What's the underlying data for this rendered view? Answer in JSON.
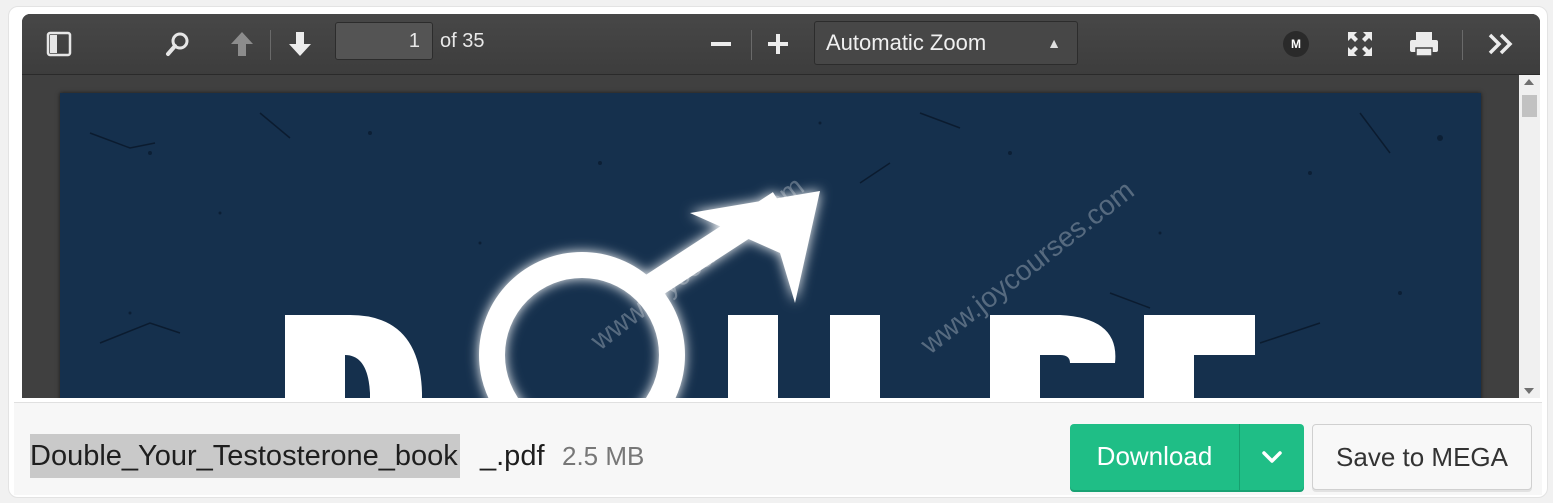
{
  "viewer": {
    "page_current": "1",
    "page_total_label": "of 35",
    "zoom_label": "Automatic Zoom",
    "mega_badge": "M",
    "cover": {
      "title_partial": "DOUBLE",
      "watermark": "www.joycourses.com"
    }
  },
  "toolbar": {
    "icons": [
      "sidebar-toggle-icon",
      "search-icon",
      "previous-page-icon",
      "next-page-icon",
      "zoom-out-icon",
      "zoom-in-icon",
      "mega-icon",
      "fullscreen-icon",
      "print-icon",
      "tools-icon"
    ]
  },
  "footer": {
    "filename": "Double_Your_Testosterone_book",
    "filename_ext": "_.pdf",
    "filesize": "2.5 MB",
    "download_label": "Download",
    "save_label": "Save to MEGA"
  },
  "colors": {
    "download_green": "#1fbe86",
    "cover_blue": "#15304d",
    "toolbar_dark": "#424242"
  }
}
